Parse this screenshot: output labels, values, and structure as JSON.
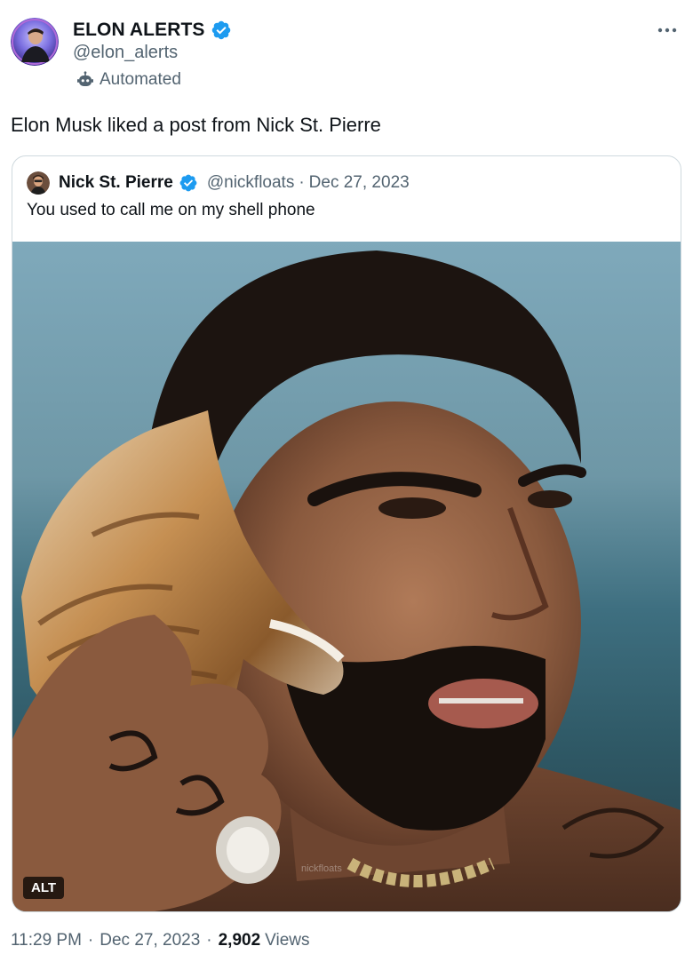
{
  "tweet": {
    "author": {
      "name": "ELON ALERTS",
      "handle": "@elon_alerts",
      "automated_label": "Automated",
      "verified": true
    },
    "text": "Elon Musk liked a post from Nick St. Pierre",
    "timestamp": "11:29 PM",
    "date": "Dec 27, 2023",
    "views_count": "2,902",
    "views_label": "Views"
  },
  "quoted": {
    "author": {
      "name": "Nick St. Pierre",
      "handle": "@nickfloats",
      "verified": true
    },
    "date": "Dec 27, 2023",
    "separator": "·",
    "text": "You used to call me on my shell phone",
    "media": {
      "alt_badge": "ALT",
      "watermark": "nickfloats"
    }
  },
  "icons": {
    "more": "more-horizontal-icon",
    "verified": "verified-badge-icon",
    "automated": "robot-icon"
  },
  "colors": {
    "verified_blue": "#1d9bf0",
    "text_primary": "#0f1419",
    "text_secondary": "#536471",
    "border": "#cfd9de"
  }
}
